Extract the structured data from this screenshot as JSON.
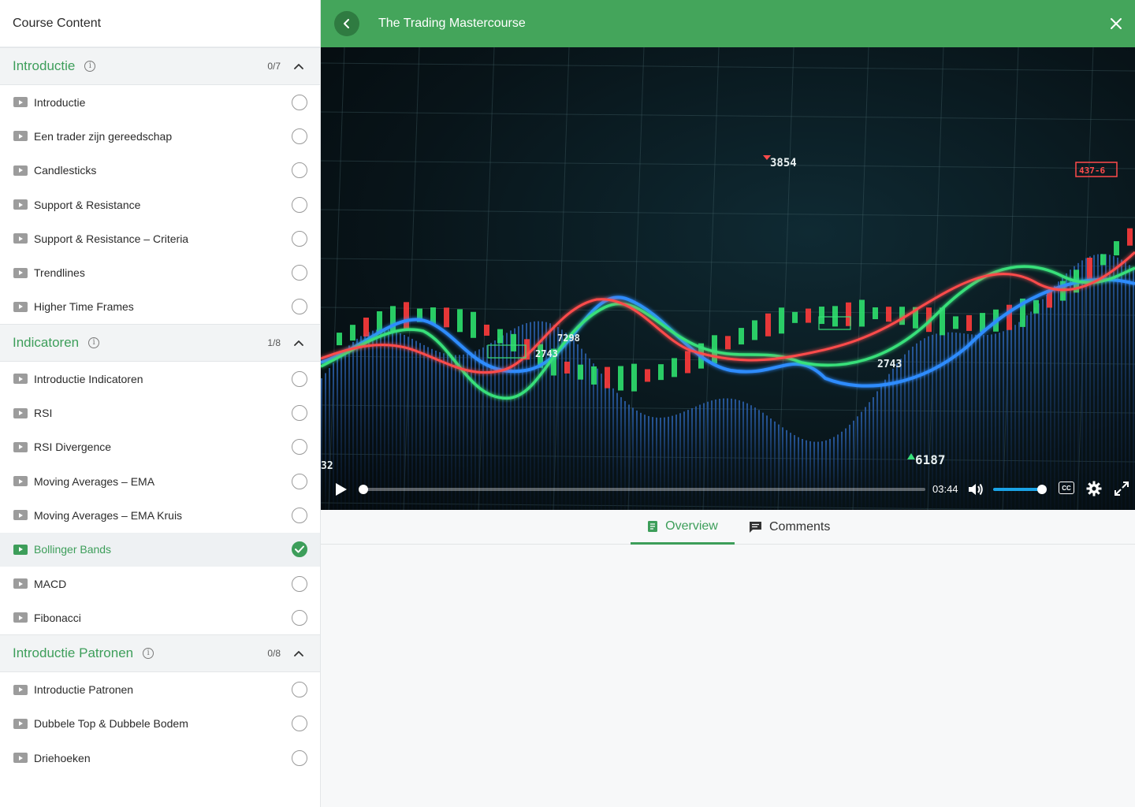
{
  "sidebar": {
    "title": "Course Content",
    "sections": [
      {
        "title": "Introductie",
        "count": "0/7",
        "lessons": [
          {
            "label": "Introductie",
            "done": false
          },
          {
            "label": "Een trader zijn gereedschap",
            "done": false
          },
          {
            "label": "Candlesticks",
            "done": false
          },
          {
            "label": "Support & Resistance",
            "done": false
          },
          {
            "label": "Support & Resistance – Criteria",
            "done": false
          },
          {
            "label": "Trendlines",
            "done": false
          },
          {
            "label": "Higher Time Frames",
            "done": false
          }
        ]
      },
      {
        "title": "Indicatoren",
        "count": "1/8",
        "lessons": [
          {
            "label": "Introductie Indicatoren",
            "done": false
          },
          {
            "label": "RSI",
            "done": false
          },
          {
            "label": "RSI Divergence",
            "done": false
          },
          {
            "label": "Moving Averages – EMA",
            "done": false
          },
          {
            "label": "Moving Averages – EMA Kruis",
            "done": false
          },
          {
            "label": "Bollinger Bands",
            "done": true,
            "active": true
          },
          {
            "label": "MACD",
            "done": false
          },
          {
            "label": "Fibonacci",
            "done": false
          }
        ]
      },
      {
        "title": "Introductie Patronen",
        "count": "0/8",
        "lessons": [
          {
            "label": "Introductie Patronen",
            "done": false
          },
          {
            "label": "Dubbele Top & Dubbele Bodem",
            "done": false
          },
          {
            "label": "Driehoeken",
            "done": false
          }
        ]
      }
    ]
  },
  "topbar": {
    "title": "The Trading Mastercourse"
  },
  "video": {
    "time": "03:44",
    "progress": 0.0,
    "volume": 0.9,
    "overlay_numbers": [
      "3854",
      "7298",
      "2743",
      "2743",
      "6187",
      "437-6",
      "32"
    ]
  },
  "tabs": {
    "overview": "Overview",
    "comments": "Comments",
    "active": "overview"
  },
  "colors": {
    "brand_green": "#44a55b",
    "accent_green": "#3d9e5a",
    "volume_blue": "#1aa3e6"
  }
}
